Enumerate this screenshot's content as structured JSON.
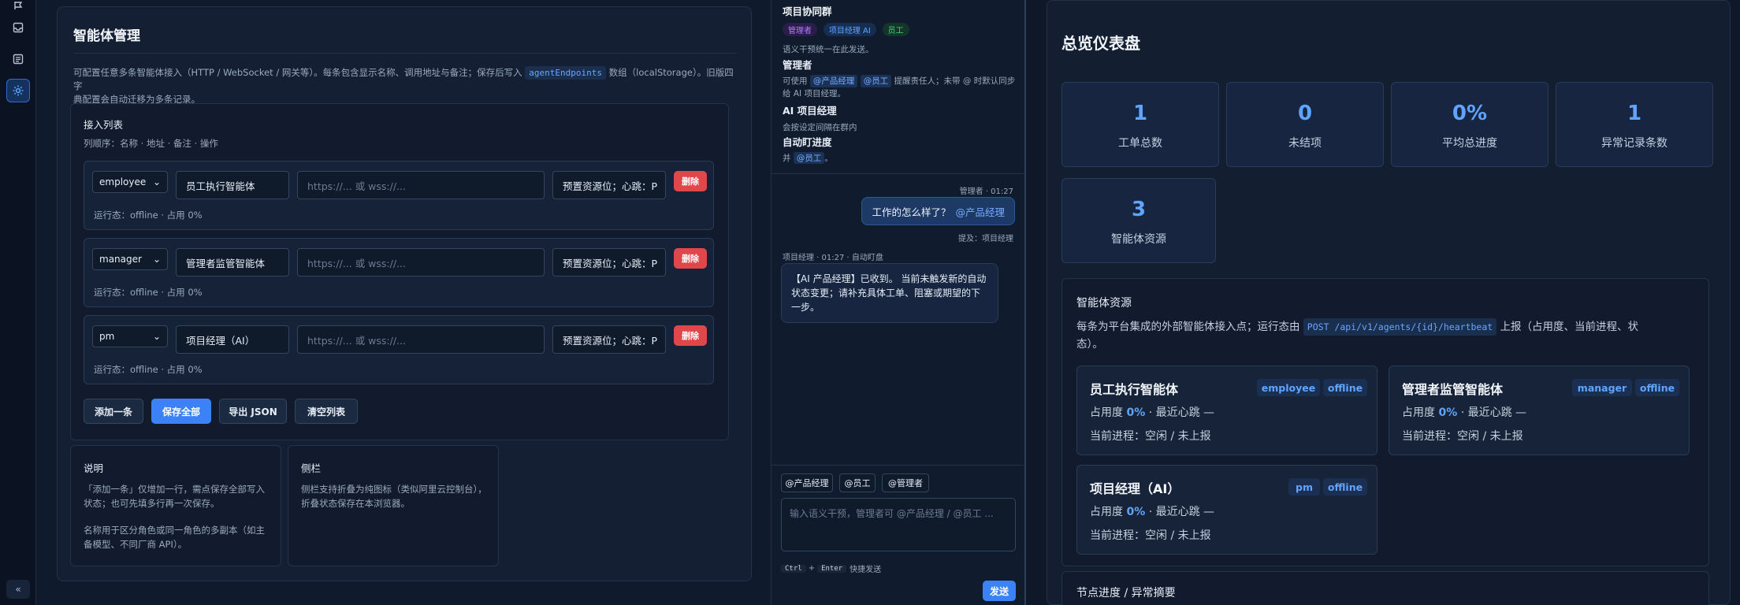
{
  "rail": {
    "items": [
      {
        "icon": "flag-icon"
      },
      {
        "icon": "inbox-icon"
      },
      {
        "icon": "document-icon"
      },
      {
        "icon": "gear-icon",
        "active": true
      }
    ],
    "collapse": "«"
  },
  "agents_panel": {
    "title": "智能体管理",
    "desc_before": "可配置任意多条智能体接入（HTTP / WebSocket / 网关等）。每条包含显示名称、调用地址与备注；保存后写入",
    "desc_code": "agentEndpoints",
    "desc_after_line1": "数组（localStorage）。旧版四字",
    "desc_line2": "典配置会自动迁移为多条记录。",
    "list_title": "接入列表",
    "column_order": "列顺序：名称 · 地址 · 备注 · 操作",
    "rows": [
      {
        "role": "employee",
        "name": "员工执行智能体",
        "url_placeholder": "https://... 或 wss://...",
        "note": "预置资源位；心跳：P",
        "delete": "删除",
        "runtime": "运行态：offline · 占用 0%"
      },
      {
        "role": "manager",
        "name": "管理者监管智能体",
        "url_placeholder": "https://... 或 wss://...",
        "note": "预置资源位；心跳：P",
        "delete": "删除",
        "runtime": "运行态：offline · 占用 0%"
      },
      {
        "role": "pm",
        "name": "项目经理（AI）",
        "url_placeholder": "https://... 或 wss://...",
        "note": "预置资源位；心跳：P",
        "delete": "删除",
        "runtime": "运行态：offline · 占用 0%"
      }
    ],
    "buttons": {
      "add": "添加一条",
      "save_all": "保存全部",
      "export": "导出 JSON",
      "clear": "清空列表"
    },
    "help": {
      "title": "说明",
      "p1": "「添加一条」仅增加一行，需点保存全部写入状态；也可先填多行再一次保存。",
      "p2": "名称用于区分角色或同一角色的多副本（如主备模型、不同厂商 API）。"
    },
    "sidebar_note": {
      "title": "侧栏",
      "p1": "侧栏支持折叠为纯图标（类似阿里云控制台），折叠状态保存在本浏览器。"
    }
  },
  "chat": {
    "group_title": "项目协同群",
    "chips": [
      {
        "label": "管理者",
        "color": "#b07cff"
      },
      {
        "label": "项目经理 AI",
        "color": "#5fa4ff"
      },
      {
        "label": "员工",
        "color": "#3fcf7e"
      }
    ],
    "intro": "语义干预统一在此发送。",
    "role1_title": "管理者",
    "role1_text_a": "可使用",
    "role1_mention1": "@产品经理",
    "role1_mention2": "@员工",
    "role1_text_b": "提醒责任人；未带 @ 时默认同步",
    "role1_text_c": "给 AI 项目经理。",
    "role2_title": "AI 项目经理",
    "role2_text": "会按设定间隔在群内",
    "role3_title": "自动盯进度",
    "role3_text_a": "并",
    "role3_mention": "@员工",
    "role3_text_b": "。",
    "msg1_meta": "管理者 · 01:27",
    "msg1_text": "工作的怎么样了？",
    "msg1_mention": "@产品经理",
    "msg1_foot": "提及：项目经理",
    "msg2_meta": "项目经理 · 01:27 · 自动盯盘",
    "msg2_text": "【AI 产品经理】已收到。 当前未触发新的自动状态变更；请补充具体工单、阻塞或期望的下一步。",
    "quick": [
      "@产品经理",
      "@员工",
      "@管理者"
    ],
    "input_placeholder": "输入语义干预，管理者可 @产品经理 / @员工 ...",
    "hint_key1": "Ctrl",
    "hint_plus": "+",
    "hint_key2": "Enter",
    "hint_text": "快捷发送",
    "send": "发送"
  },
  "dashboard": {
    "title": "总览仪表盘",
    "stats": [
      {
        "value": "1",
        "label": "工单总数"
      },
      {
        "value": "0",
        "label": "未结项"
      },
      {
        "value": "0%",
        "label": "平均总进度"
      },
      {
        "value": "1",
        "label": "异常记录条数"
      },
      {
        "value": "3",
        "label": "智能体资源"
      }
    ],
    "resources_title": "智能体资源",
    "resources_desc_a": "每条为平台集成的外部智能体接入点；运行态由",
    "resources_code": "POST /api/v1/agents/{id}/heartbeat",
    "resources_desc_b": "上报（占用度、当前进程、状",
    "resources_desc_c": "态）。",
    "agents": [
      {
        "name": "员工执行智能体",
        "role": "employee",
        "status": "offline",
        "usage_label": "占用度",
        "usage": "0%",
        "heartbeat": "· 最近心跳 —",
        "process": "当前进程：空闲 / 未上报"
      },
      {
        "name": "管理者监管智能体",
        "role": "manager",
        "status": "offline",
        "usage_label": "占用度",
        "usage": "0%",
        "heartbeat": "· 最近心跳 —",
        "process": "当前进程：空闲 / 未上报"
      },
      {
        "name": "项目经理（AI）",
        "role": "pm",
        "status": "offline",
        "usage_label": "占用度",
        "usage": "0%",
        "heartbeat": "· 最近心跳 —",
        "process": "当前进程：空闲 / 未上报"
      }
    ],
    "progress_title": "节点进度 / 异常摘要"
  }
}
